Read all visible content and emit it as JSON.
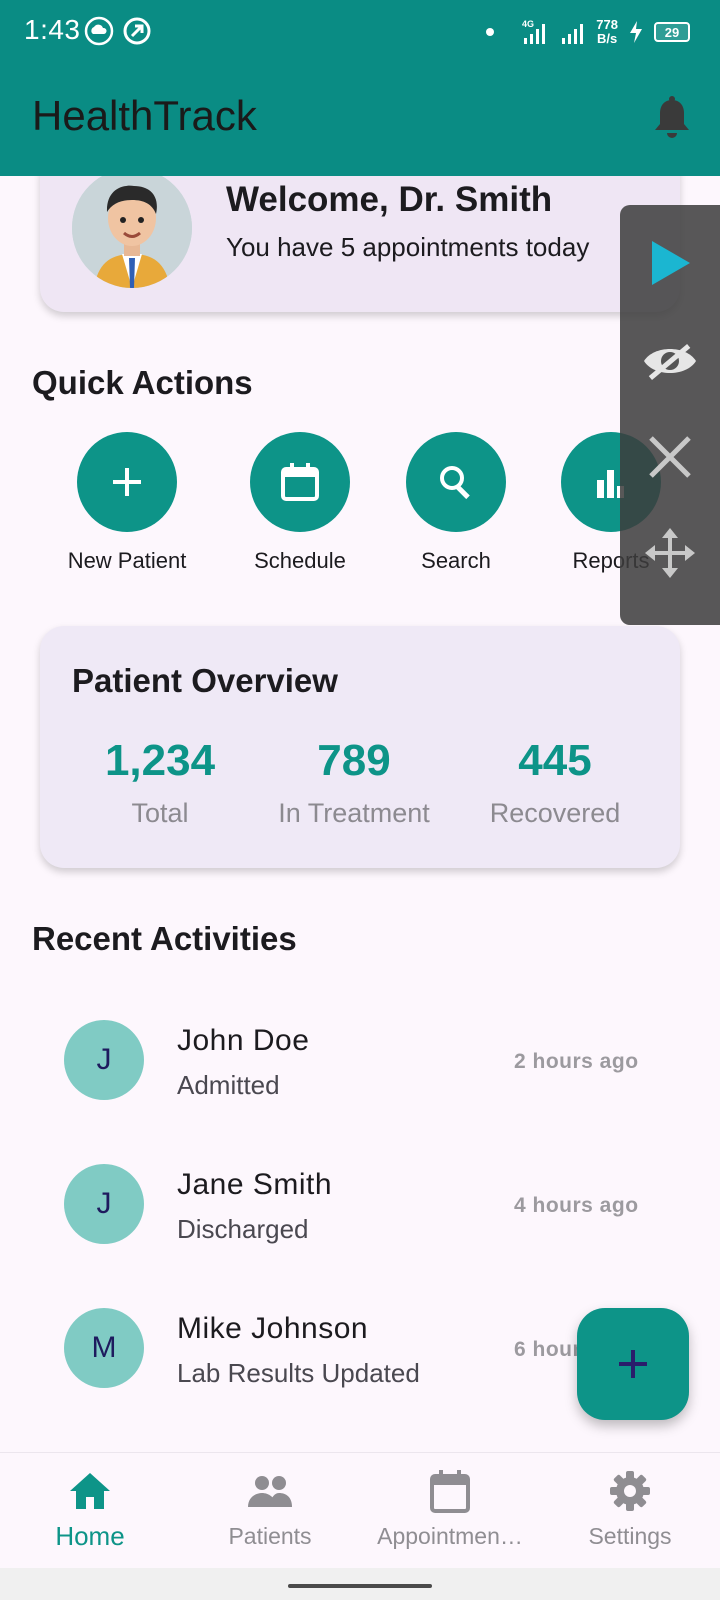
{
  "status_bar": {
    "time": "1:43",
    "network_type": "4G",
    "net_speed_value": "778",
    "net_speed_unit": "B/s",
    "battery": "29"
  },
  "app_bar": {
    "title": "HealthTrack",
    "notification_icon": "bell-icon"
  },
  "welcome": {
    "title": "Welcome, Dr. Smith",
    "subtitle": "You have 5 appointments today"
  },
  "quick_actions": {
    "title": "Quick Actions",
    "items": [
      {
        "label": "New Patient",
        "icon": "plus-icon"
      },
      {
        "label": "Schedule",
        "icon": "calendar-icon"
      },
      {
        "label": "Search",
        "icon": "search-icon"
      },
      {
        "label": "Reports",
        "icon": "bar-chart-icon"
      }
    ]
  },
  "overview": {
    "title": "Patient Overview",
    "stats": [
      {
        "value": "1,234",
        "label": "Total"
      },
      {
        "value": "789",
        "label": "In Treatment"
      },
      {
        "value": "445",
        "label": "Recovered"
      }
    ]
  },
  "recent_activities": {
    "title": "Recent Activities",
    "items": [
      {
        "initial": "J",
        "name": "John Doe",
        "status": "Admitted",
        "time": "2 hours ago"
      },
      {
        "initial": "J",
        "name": "Jane Smith",
        "status": "Discharged",
        "time": "4 hours ago"
      },
      {
        "initial": "M",
        "name": "Mike Johnson",
        "status": "Lab Results Updated",
        "time": "6 hours ago"
      }
    ]
  },
  "bottom_nav": {
    "items": [
      {
        "label": "Home",
        "icon": "home-icon",
        "active": true
      },
      {
        "label": "Patients",
        "icon": "people-icon",
        "active": false
      },
      {
        "label": "Appointmen…",
        "icon": "calendar-icon",
        "active": false
      },
      {
        "label": "Settings",
        "icon": "gear-icon",
        "active": false
      }
    ]
  },
  "colors": {
    "primary": "#0d9488",
    "app_bar": "#0a8c84",
    "card_bg": "#efe6f4",
    "avatar_bg": "#80cbc4"
  }
}
